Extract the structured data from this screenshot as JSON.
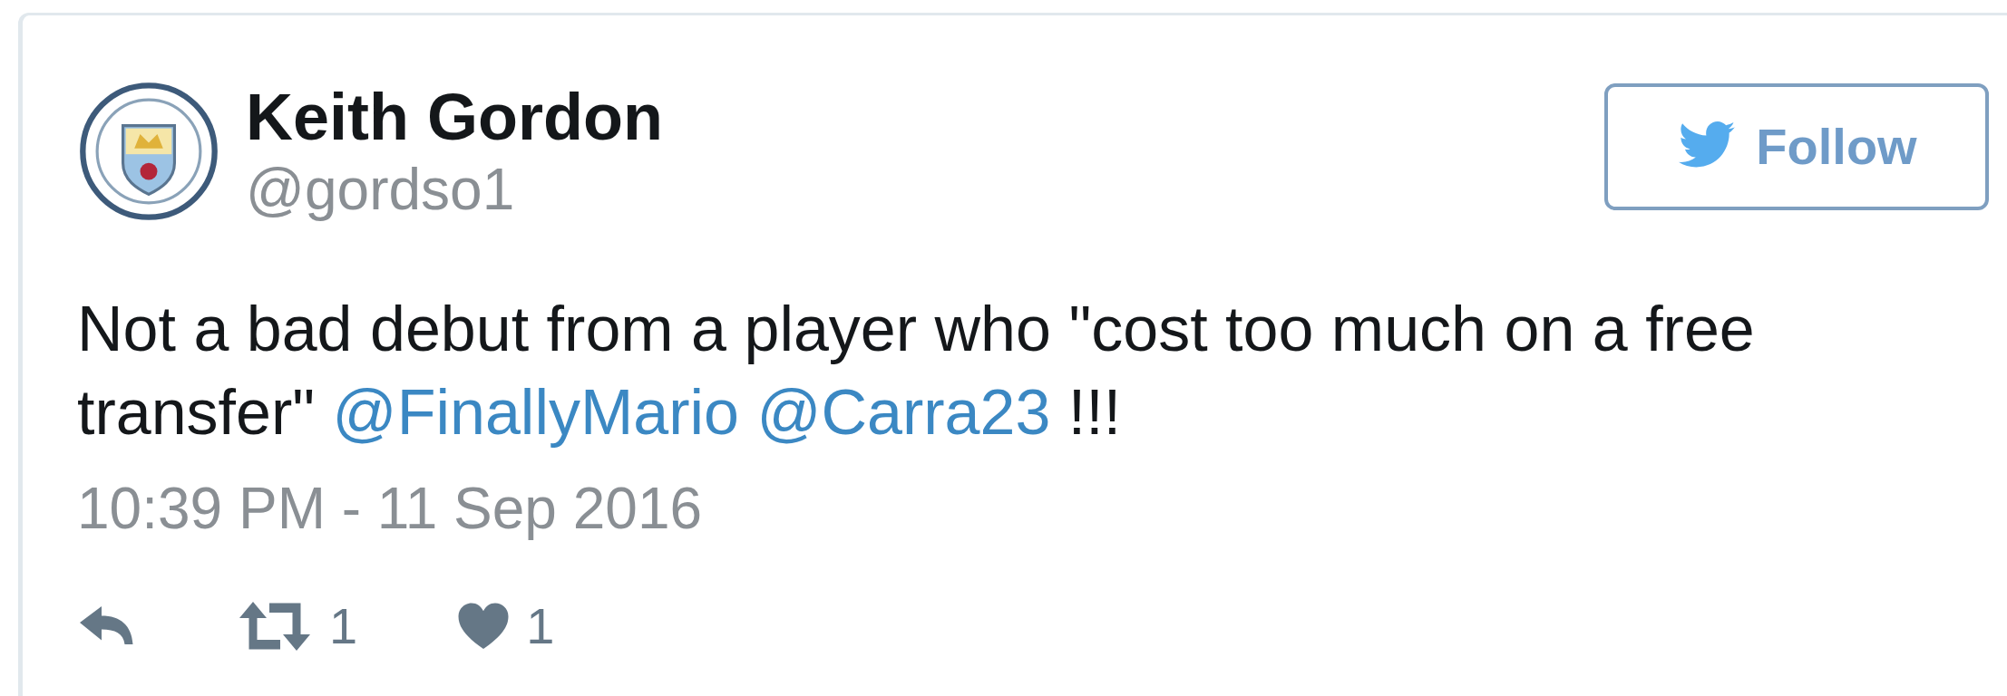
{
  "author": {
    "name": "Keith Gordon",
    "handle": "@gordso1"
  },
  "follow_button": {
    "label": "Follow"
  },
  "body": [
    {
      "kind": "text",
      "text": "Not a bad debut from a player who \"cost too much on a free transfer\" "
    },
    {
      "kind": "mention",
      "text": "@FinallyMario"
    },
    {
      "kind": "mention",
      "text": "@Carra23"
    },
    {
      "kind": "text",
      "text": " !!!"
    }
  ],
  "timestamp": "10:39 PM - 11 Sep 2016",
  "actions": [
    {
      "kind": "reply"
    },
    {
      "kind": "retweet",
      "count": "1"
    },
    {
      "kind": "like",
      "count": "1"
    }
  ]
}
